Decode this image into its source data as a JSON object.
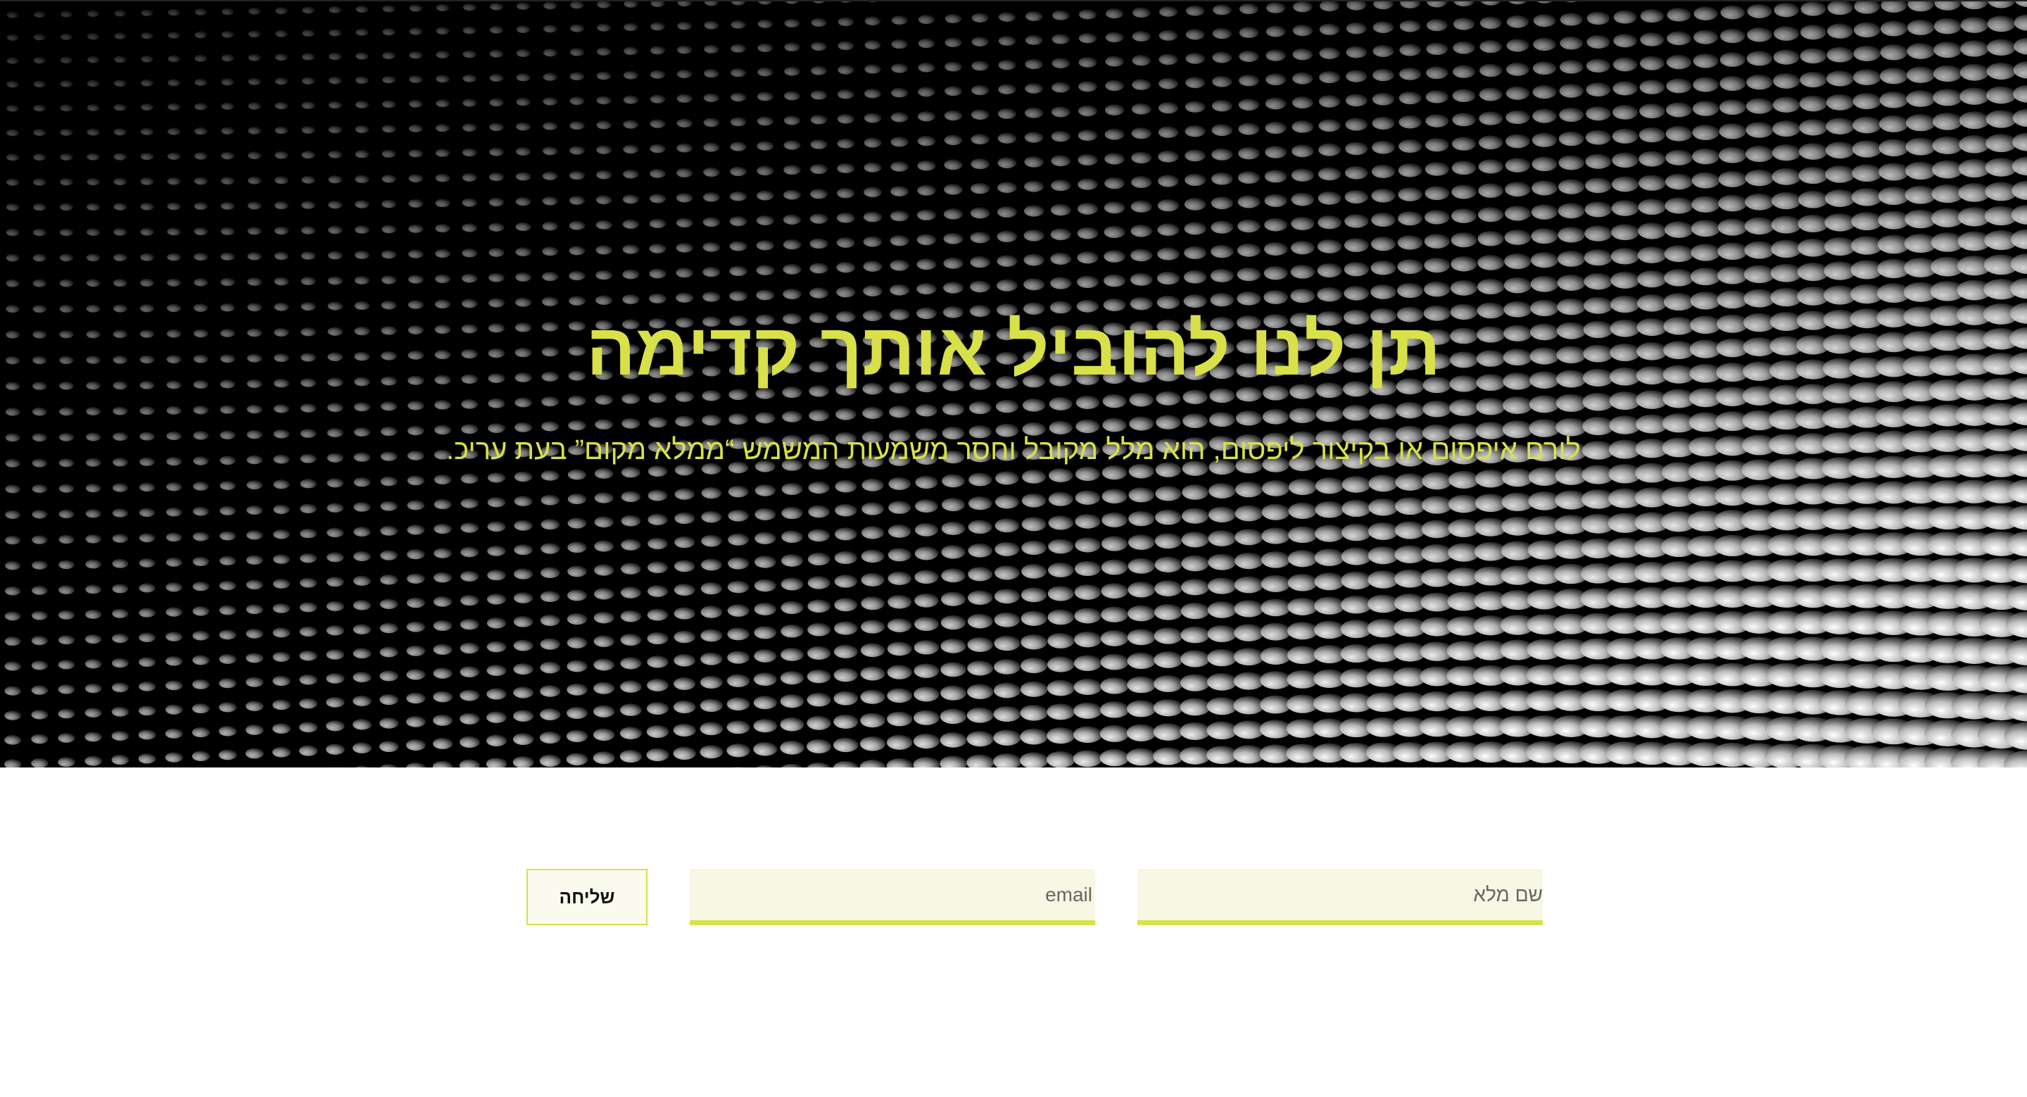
{
  "hero": {
    "title": "תן לנו להוביל אותך קדימה",
    "subtitle": "לורם איפסום או בקיצור ליפסום, הוא מלל מקובל וחסר משמעות המשמש “ממלא מקום” בעת עריכ."
  },
  "form": {
    "name_placeholder": "שם מלא",
    "email_placeholder": "email",
    "submit_label": "שליחה"
  },
  "colors": {
    "accent": "#d8e04a",
    "hero_background": "#000000",
    "field_background": "#f7f7e3"
  },
  "icons": {
    "hero_background": "dotted-sphere-wave-pattern"
  }
}
